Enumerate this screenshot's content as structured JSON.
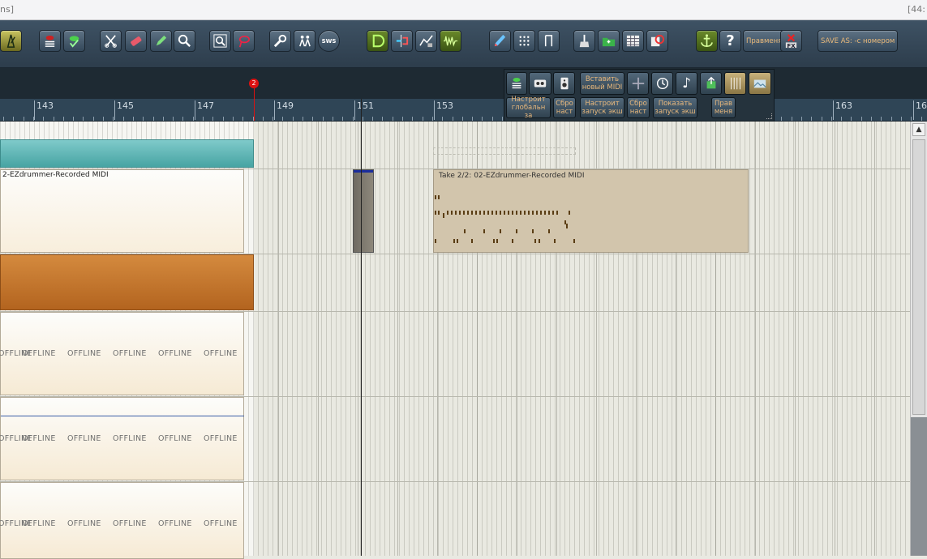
{
  "window": {
    "title_left": "ns]",
    "title_right": "[44:"
  },
  "toolbar": {
    "icons": [
      "metronome-icon",
      "mixer-eye-icon",
      "show-hide-icon",
      "cut-icon",
      "eraser-icon",
      "pencil-icon",
      "zoom-icon",
      "magnify-glass-icon",
      "lasso-icon",
      "wrench-icon",
      "people-icon",
      "sws-icon",
      "snap-icon",
      "ripple-icon",
      "envelope-icon",
      "waveform-icon",
      "brush-icon",
      "grid-icon",
      "bracket-icon",
      "broom-icon",
      "folder-icon",
      "table-icon",
      "render-icon",
      "anchor-icon",
      "help-icon",
      "fx-icon"
    ],
    "sws_label": "SWS",
    "prav_line1": "Прав",
    "prav_line2": "меня",
    "fx_label": "FX",
    "save_line1": "SAVE AS: -",
    "save_line2": "с номером"
  },
  "floating_toolbar": {
    "insert_midi_line1": "Вставить",
    "insert_midi_line2": "новый MIDI",
    "global_line1": "Настроит",
    "global_line2": "глобальн за",
    "reset1_line1": "Сбро",
    "reset1_line2": "наст",
    "launch_line1": "Настроит",
    "launch_line2": "запуск экш",
    "reset2_line1": "Сбро",
    "reset2_line2": "наст",
    "show_line1": "Показать",
    "show_line2": "запуск экш",
    "edit_line1": "Прав",
    "edit_line2": "меня"
  },
  "timeline": {
    "bars": [
      "143",
      "145",
      "147",
      "149",
      "151",
      "153",
      "163",
      "16"
    ],
    "marker_number": "2"
  },
  "items": {
    "midi_left_label": "2-EZdrummer-Recorded MIDI",
    "take_label": "Take 2/2: 02-EZdrummer-Recorded MIDI",
    "offline_text": "OFFLINE"
  },
  "colors": {
    "teal_item": "#5fb6b4",
    "orange_item": "#c07630",
    "toolbar_bg": "#34485a",
    "marker_red": "#dd1111"
  }
}
